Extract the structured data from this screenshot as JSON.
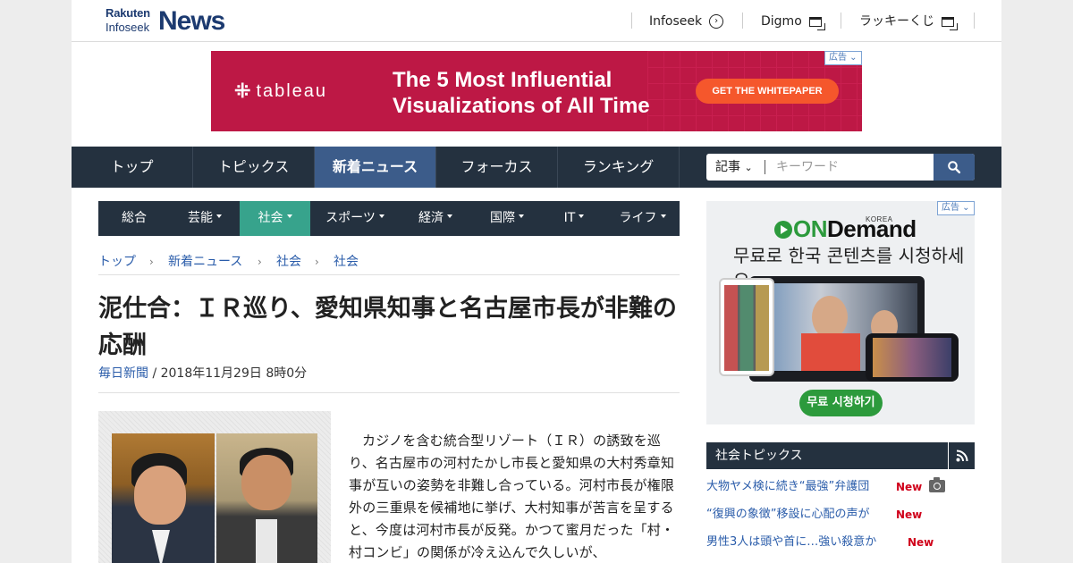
{
  "header": {
    "logo_brand": "Rakuten",
    "logo_sub": "Infoseek",
    "logo_news": "News",
    "links": [
      {
        "label": "Infoseek",
        "icon": "circle-arrow-icon"
      },
      {
        "label": "Digmo",
        "icon": "new-window-icon"
      },
      {
        "label": "ラッキーくじ",
        "icon": "new-window-icon"
      }
    ]
  },
  "ad_top": {
    "brand": "tableau",
    "headline_line1": "The 5 Most Influential",
    "headline_line2": "Visualizations of All Time",
    "cta": "GET THE WHITEPAPER",
    "badge": "広告",
    "bg_color": "#bd1845",
    "cta_color": "#f5572c"
  },
  "main_nav": {
    "items": [
      {
        "label": "トップ"
      },
      {
        "label": "トピックス"
      },
      {
        "label": "新着ニュース",
        "active": true
      },
      {
        "label": "フォーカス"
      },
      {
        "label": "ランキング"
      }
    ],
    "search": {
      "scope": "記事",
      "placeholder": "キーワード"
    }
  },
  "sub_nav": {
    "items": [
      {
        "label": "総合"
      },
      {
        "label": "芸能"
      },
      {
        "label": "社会",
        "active": true
      },
      {
        "label": "スポーツ"
      },
      {
        "label": "経済"
      },
      {
        "label": "国際"
      },
      {
        "label": "IT"
      },
      {
        "label": "ライフ"
      }
    ]
  },
  "breadcrumb": [
    "トップ",
    "新着ニュース",
    "社会",
    "社会"
  ],
  "article": {
    "title": "泥仕合：ＩＲ巡り、愛知県知事と名古屋市長が非難の応酬",
    "source": "毎日新聞",
    "date": " / 2018年11月29日 8時0分",
    "body": "カジノを含む統合型リゾート（ＩＲ）の誘致を巡り、名古屋市の河村たかし市長と愛知県の大村秀章知事が互いの姿勢を非難し合っている。河村市長が権限外の三重県を候補地に挙げ、大村知事が苦言を呈すると、今度は河村市長が反発。かつて蜜月だった「村・村コンビ」の関係が冷え込んで久しいが、"
  },
  "ad_right": {
    "brand_on": "ON",
    "brand_demand": "Demand",
    "brand_korea": "KOREA",
    "tagline": "무료로 한국 콘텐츠를 시청하세요",
    "cta": "무료 시청하기",
    "badge": "広告",
    "accent_color": "#2c9a3c"
  },
  "topics": {
    "title": "社会トピックス",
    "items": [
      {
        "label": "大物ヤメ検に続き“最強”弁護団",
        "badge": "New",
        "has_photo": true
      },
      {
        "label": "“復興の象徴”移設に心配の声が",
        "badge": "New",
        "has_photo": false
      },
      {
        "label": "男性3人は頭や首に…強い殺意か",
        "badge": "New",
        "has_photo": false
      }
    ]
  },
  "colors": {
    "nav_dark": "#24313f",
    "nav_active": "#3c5c8a",
    "subnav_active": "#37a38c",
    "link_blue": "#2a5caa",
    "new_red": "#d0021b"
  }
}
